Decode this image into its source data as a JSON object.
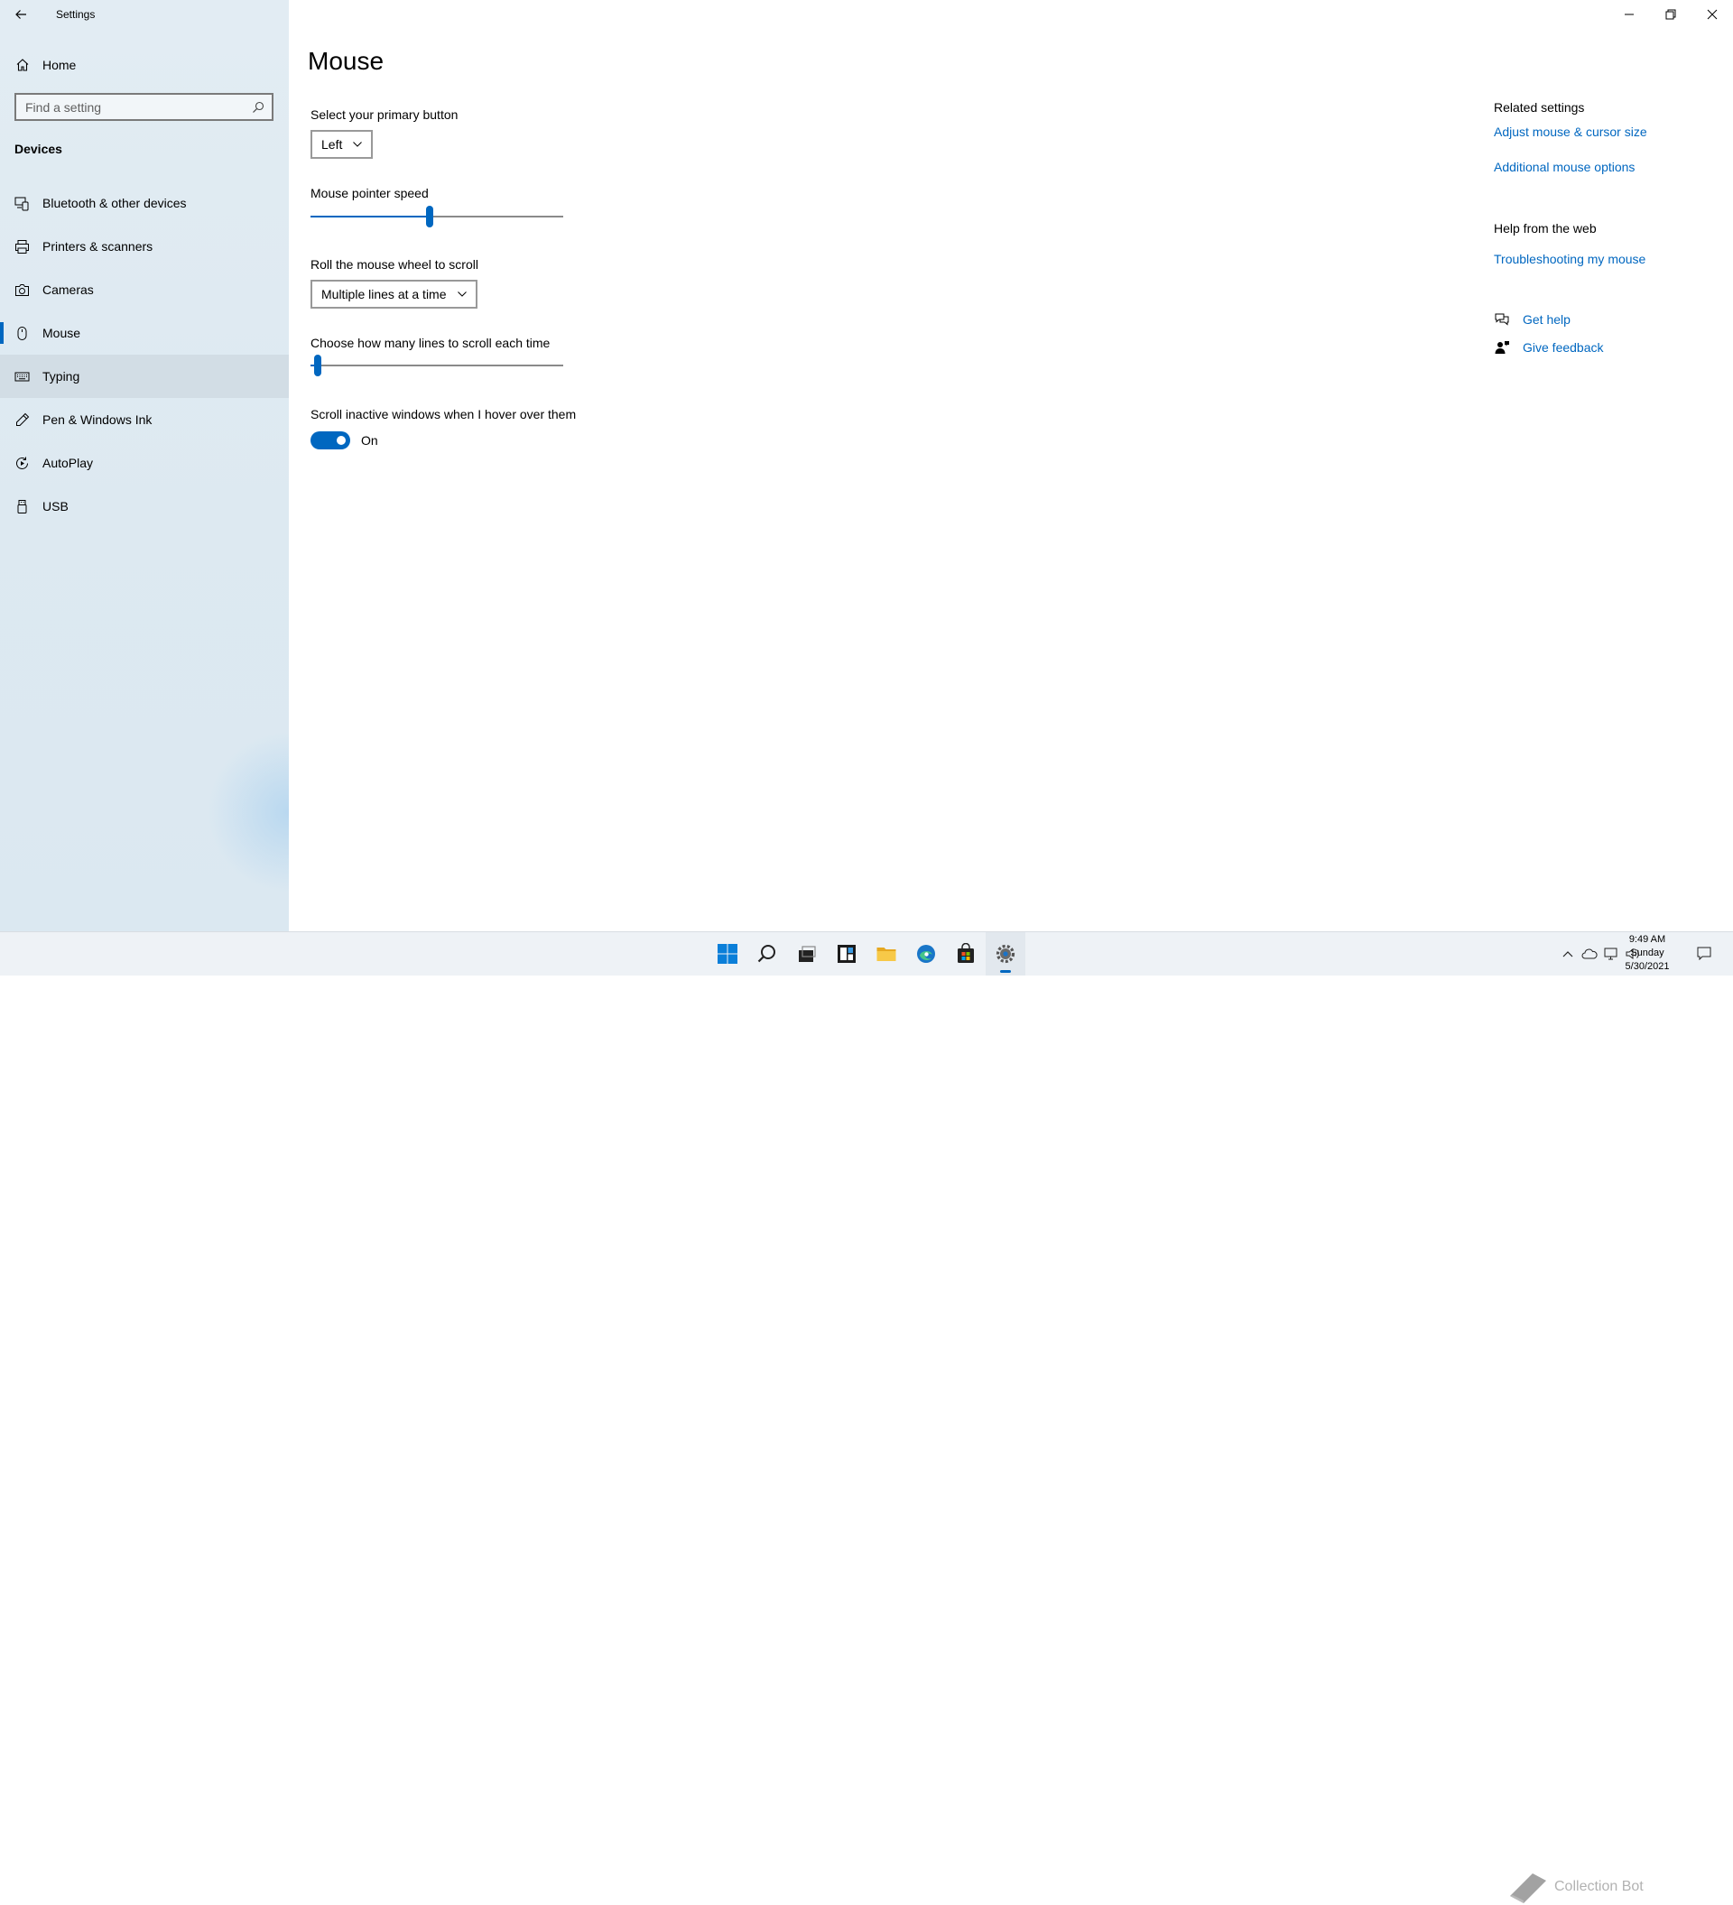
{
  "window": {
    "title": "Settings"
  },
  "sidebar": {
    "home_label": "Home",
    "search_placeholder": "Find a setting",
    "section_header": "Devices",
    "items": [
      {
        "label": "Bluetooth & other devices",
        "icon": "bluetooth-devices-icon"
      },
      {
        "label": "Printers & scanners",
        "icon": "printer-icon"
      },
      {
        "label": "Cameras",
        "icon": "camera-icon"
      },
      {
        "label": "Mouse",
        "icon": "mouse-icon",
        "selected": true
      },
      {
        "label": "Typing",
        "icon": "keyboard-icon",
        "hover": true
      },
      {
        "label": "Pen & Windows Ink",
        "icon": "pen-icon"
      },
      {
        "label": "AutoPlay",
        "icon": "autoplay-icon"
      },
      {
        "label": "USB",
        "icon": "usb-icon"
      }
    ]
  },
  "main": {
    "title": "Mouse",
    "primary_button": {
      "label": "Select your primary button",
      "value": "Left"
    },
    "pointer_speed": {
      "label": "Mouse pointer speed",
      "value_fraction": 0.47
    },
    "scroll_mode": {
      "label": "Roll the mouse wheel to scroll",
      "value": "Multiple lines at a time"
    },
    "scroll_lines": {
      "label": "Choose how many lines to scroll each time",
      "value_fraction": 0.03
    },
    "inactive_scroll": {
      "label": "Scroll inactive windows when I hover over them",
      "state": "On",
      "on": true
    }
  },
  "related": {
    "heading": "Related settings",
    "link1": "Adjust mouse & cursor size",
    "link2": "Additional mouse options",
    "help_heading": "Help from the web",
    "help_link": "Troubleshooting my mouse",
    "get_help": "Get help",
    "give_feedback": "Give feedback"
  },
  "taskbar": {
    "apps": [
      "start-icon",
      "search-icon",
      "task-view-icon",
      "widgets-icon",
      "file-explorer-icon",
      "edge-icon",
      "store-icon",
      "settings-icon"
    ],
    "time": "9:49 AM",
    "day": "Sunday",
    "date": "5/30/2021",
    "watermark_text": "Collection Bot"
  },
  "colors": {
    "accent": "#0067c0",
    "sidebar_bg": "#e2ecf3",
    "hover_bg": "#d2dde5"
  }
}
